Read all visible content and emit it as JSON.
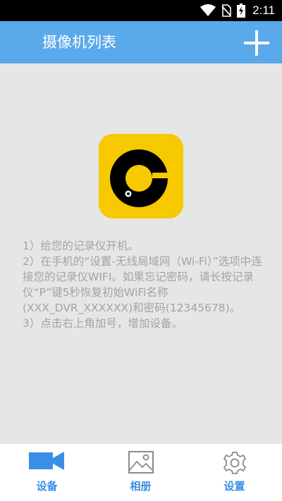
{
  "status_bar": {
    "time": "2:11",
    "icons": [
      "wifi-icon",
      "no-sim-icon",
      "battery-charging-icon"
    ]
  },
  "header": {
    "title": "摄像机列表",
    "add_icon": "plus-icon"
  },
  "colors": {
    "app_bar": "#5aa9eb",
    "nav_active": "#3a8ee6",
    "nav_inactive": "#8a8a8a",
    "instruction_text": "#a3a3a3",
    "logo_yellow": "#f6c900"
  },
  "instructions": [
    "1）给您的记录仪开机。",
    "2）在手机的“设置-无线局域网（Wi-Fi）”选项中连接您的记录仪WIFI。如果忘记密码，请长按记录仪“P”键5秒恢复初始WiFi名称(XXX_DVR_XXXXXX)和密码(12345678)。",
    "3）点击右上角加号，增加设备。"
  ],
  "bottom_nav": [
    {
      "label": "设备",
      "icon": "video-camera-icon",
      "active": true
    },
    {
      "label": "相册",
      "icon": "image-icon",
      "active": false
    },
    {
      "label": "设置",
      "icon": "gear-icon",
      "active": false
    }
  ]
}
